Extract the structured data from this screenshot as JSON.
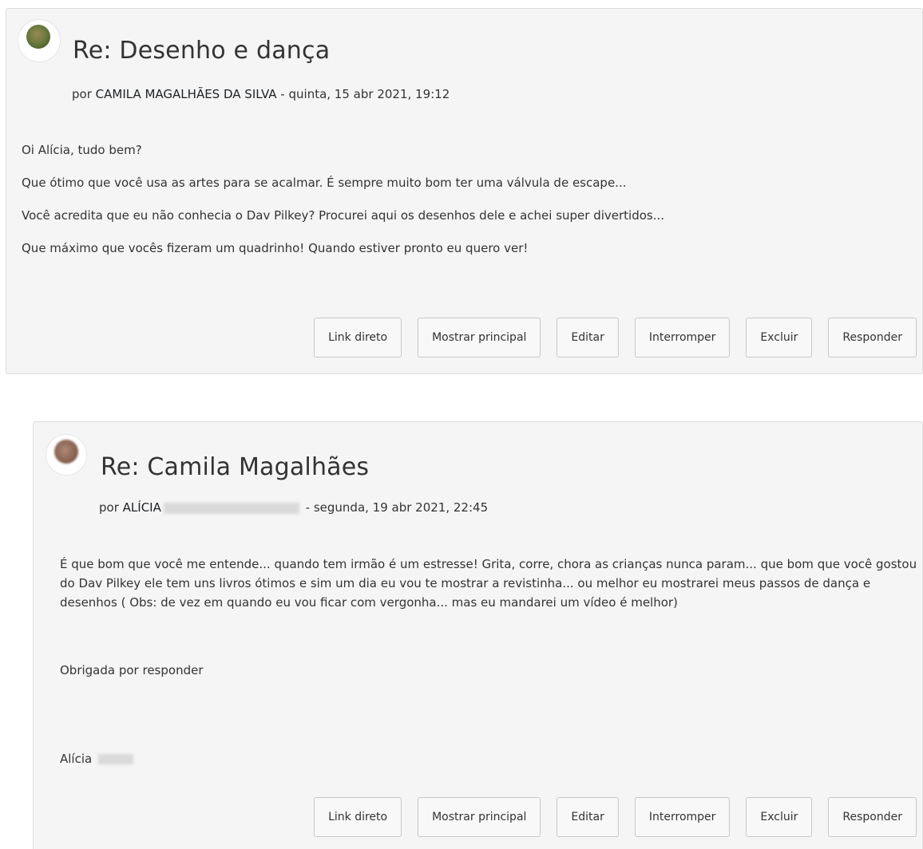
{
  "posts": [
    {
      "subject": "Re: Desenho e dança",
      "by_prefix": "por",
      "author": "CAMILA MAGALHÃES DA SILVA",
      "separator": "-",
      "date": "quinta, 15 abr 2021, 19:12",
      "message": [
        "Oi Alícia, tudo bem?",
        "Que ótimo que você usa as artes para se acalmar. É sempre muito bom ter uma válvula de escape...",
        "Você acredita que eu não conhecia o Dav Pilkey? Procurei aqui os desenhos dele e achei super divertidos...",
        "Que máximo que vocês fizeram um quadrinho! Quando estiver pronto eu quero ver!"
      ],
      "actions": [
        "Link direto",
        "Mostrar principal",
        "Editar",
        "Interromper",
        "Excluir",
        "Responder"
      ]
    },
    {
      "subject": "Re: Camila Magalhães",
      "by_prefix": "por",
      "author": "ALÍCIA",
      "separator": "-",
      "date": "segunda, 19 abr 2021, 22:45",
      "message": [
        "É que bom que você me entende... quando tem irmão é um estresse! Grita, corre, chora as crianças nunca param... que bom que você gostou do Dav Pilkey ele tem uns livros ótimos e sim um dia eu vou te mostrar a revistinha... ou melhor eu mostrarei meus passos de dança e desenhos ( Obs: de vez em quando eu vou ficar com vergonha... mas eu mandarei um vídeo é melhor)",
        "Obrigada por responder",
        "Alícia"
      ],
      "actions": [
        "Link direto",
        "Mostrar principal",
        "Editar",
        "Interromper",
        "Excluir",
        "Responder"
      ]
    }
  ]
}
